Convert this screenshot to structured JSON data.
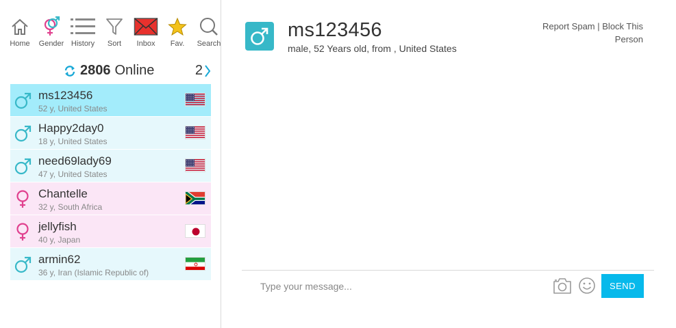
{
  "toolbar": {
    "items": [
      {
        "label": "Home",
        "icon": "home-icon"
      },
      {
        "label": "Gender",
        "icon": "gender-icon"
      },
      {
        "label": "History",
        "icon": "history-list-icon"
      },
      {
        "label": "Sort",
        "icon": "funnel-icon"
      },
      {
        "label": "Inbox",
        "icon": "envelope-icon"
      },
      {
        "label": "Fav.",
        "icon": "star-icon"
      },
      {
        "label": "Search",
        "icon": "search-icon"
      }
    ]
  },
  "online": {
    "count": "2806",
    "label": "Online",
    "page": "2"
  },
  "users": [
    {
      "name": "ms123456",
      "meta": "52 y, United States",
      "gender": "male",
      "flag": "us",
      "active": true
    },
    {
      "name": "Happy2day0",
      "meta": "18 y, United States",
      "gender": "male",
      "flag": "us",
      "active": false
    },
    {
      "name": "need69lady69",
      "meta": "47 y, United States",
      "gender": "male",
      "flag": "us",
      "active": false
    },
    {
      "name": "Chantelle",
      "meta": "32 y, South Africa",
      "gender": "female",
      "flag": "za",
      "active": false
    },
    {
      "name": "jellyfish",
      "meta": "40 y, Japan",
      "gender": "female",
      "flag": "jp",
      "active": false
    },
    {
      "name": "armin62",
      "meta": "36 y, Iran (Islamic Republic of)",
      "gender": "male",
      "flag": "ir",
      "active": false
    }
  ],
  "chat": {
    "name": "ms123456",
    "subtitle": "male, 52 Years old, from , United States",
    "report_spam": "Report Spam",
    "separator": "|",
    "block_person": "Block This Person",
    "input_placeholder": "Type your message...",
    "send_label": "SEND"
  },
  "colors": {
    "male": "#37b8c8",
    "female": "#e0408e",
    "active_row": "#a3ecfb",
    "male_row": "#e6f8fc",
    "female_row": "#fbe6f6",
    "send_button": "#07b9eb",
    "inbox_red": "#e8312d",
    "star_gold": "#f3c21b"
  }
}
